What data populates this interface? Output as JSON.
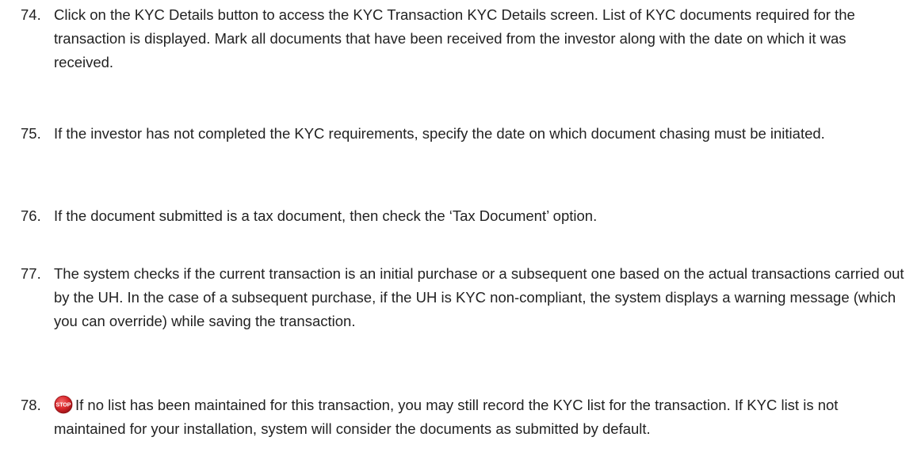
{
  "steps": [
    {
      "number": "74.",
      "text": "Click on the KYC Details button to access the KYC Transaction KYC Details screen. List of KYC documents required for the transaction is displayed. Mark all documents that have been received from the investor along with the date on which it was received."
    },
    {
      "number": "75.",
      "text": "If the investor has not completed the KYC requirements, specify the date on which document chasing must be initiated."
    },
    {
      "number": "76.",
      "text": "If the document submitted is a tax document, then check the ‘Tax Document’ option."
    },
    {
      "number": "77.",
      "text": "The system checks if the current transaction is an initial purchase or a subsequent one based on the actual transactions carried out by the UH. In the case of a subsequent purchase, if the UH is KYC non-compliant, the system displays a warning message (which you can override) while saving the transaction."
    },
    {
      "number": "78.",
      "icon": "stop-icon",
      "icon_label": "STOP",
      "text": "If no list has been maintained for this transaction, you may still record the KYC list for the transaction. If KYC list is not maintained for your installation, system will consider the documents as submitted by default."
    }
  ],
  "colors": {
    "text": "#222222",
    "stop_icon": "#d9262b"
  }
}
